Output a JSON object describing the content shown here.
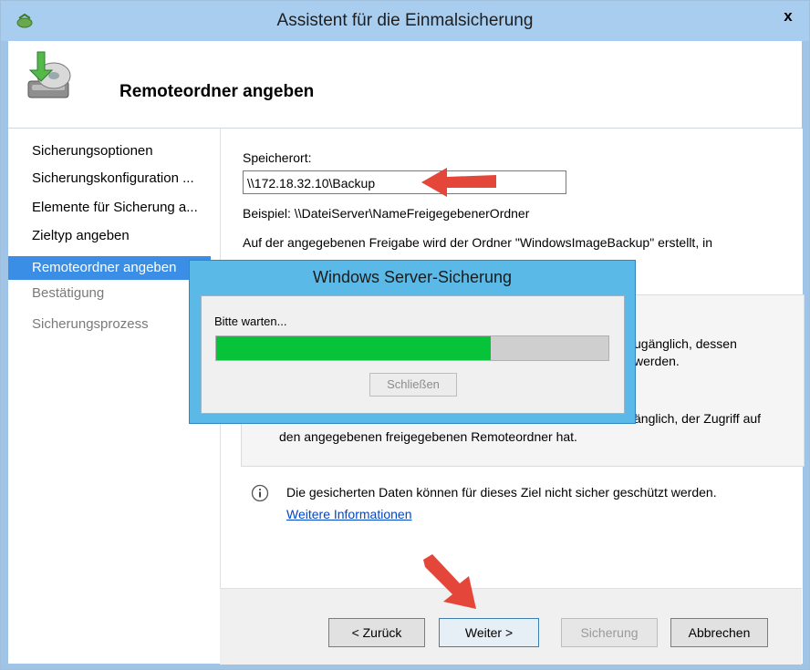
{
  "window": {
    "title": "Assistent für die Einmalsicherung",
    "close_label": "x"
  },
  "header": {
    "title": "Remoteordner angeben"
  },
  "nav": {
    "items": [
      {
        "label": "Sicherungsoptionen",
        "state": "normal"
      },
      {
        "label": "Sicherungskonfiguration ...",
        "state": "normal"
      },
      {
        "label": "Elemente für Sicherung a...",
        "state": "normal"
      },
      {
        "label": "Zieltyp angeben",
        "state": "normal"
      },
      {
        "label": "Remoteordner angeben",
        "state": "active"
      },
      {
        "label": "Bestätigung",
        "state": "disabled"
      },
      {
        "label": "Sicherungsprozess",
        "state": "disabled"
      }
    ]
  },
  "main": {
    "location_label": "Speicherort:",
    "location_value": "\\\\172.18.32.10\\Backup",
    "example_text": "Beispiel: \\\\DateiServer\\NameFreigegebenerOrdner",
    "description_line1": "Auf der angegebenen Freigabe wird der Ordner \"WindowsImageBackup\" erstellt, in",
    "option1_tail_line1": "ugänglich, dessen",
    "option1_tail_line2": "werden.",
    "option2_tail_line1": "änglich, der Zugriff auf",
    "option2_line2": "den angegebenen freigegebenen Remoteordner hat.",
    "info_text": "Die gesicherten Daten können für dieses Ziel nicht sicher geschützt werden.",
    "info_link": "Weitere Informationen"
  },
  "buttons": {
    "back": "< Zurück",
    "next": "Weiter >",
    "backup": "Sicherung",
    "cancel": "Abbrechen"
  },
  "modal": {
    "title": "Windows Server-Sicherung",
    "message": "Bitte warten...",
    "progress": 0.7,
    "close_label": "Schließen"
  },
  "colors": {
    "progress_fill": "#06c33a",
    "arrow": "#e5463a",
    "nav_active": "#3a8ee6"
  }
}
